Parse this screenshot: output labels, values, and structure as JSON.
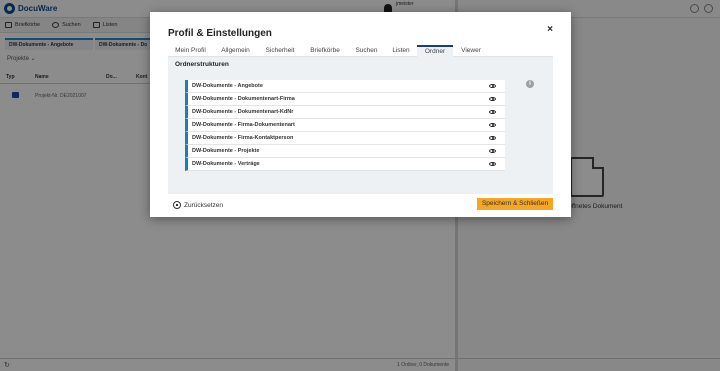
{
  "app": {
    "logo_text": "DocuWare",
    "user_name": "jmeister",
    "toolbar": [
      "Briefkörbe",
      "Suchen",
      "Listen"
    ],
    "doc_tabs": [
      "DW-Dokumente - Angebote",
      "DW-Dokumente - Do"
    ],
    "projekte_label": "Projekte ⌄",
    "list_columns": [
      "Typ",
      "Name",
      "Do...",
      "Kont"
    ],
    "list_row_name": "Projekt-Nr. DE2021007",
    "status_text": "1 Ordner, 0 Dokumente",
    "preview_caption": "öffnetes Dokument"
  },
  "modal": {
    "title": "Profil & Einstellungen",
    "close": "×",
    "tabs": [
      "Mein Profil",
      "Allgemein",
      "Sicherheit",
      "Briefkörbe",
      "Suchen",
      "Listen",
      "Ordner",
      "Viewer"
    ],
    "active_tab": "Ordner",
    "section_title": "Ordnerstrukturen",
    "info_icon": "i",
    "folders": [
      "DW-Dokumente - Angebote",
      "DW-Dokumente - Dokumentenart-Firma",
      "DW-Dokumente - Dokumentenart-KdNr",
      "DW-Dokumente - Firma-Dokumentenart",
      "DW-Dokumente - Firma-Kontaktperson",
      "DW-Dokumente - Projekte",
      "DW-Dokumente - Verträge"
    ],
    "reset_label": "Zurücksetzen",
    "save_label": "Speichern & Schließen"
  },
  "colors": {
    "accent": "#1e7fa8",
    "active_tab_border": "#1a3e78",
    "save_button": "#f5a623"
  }
}
